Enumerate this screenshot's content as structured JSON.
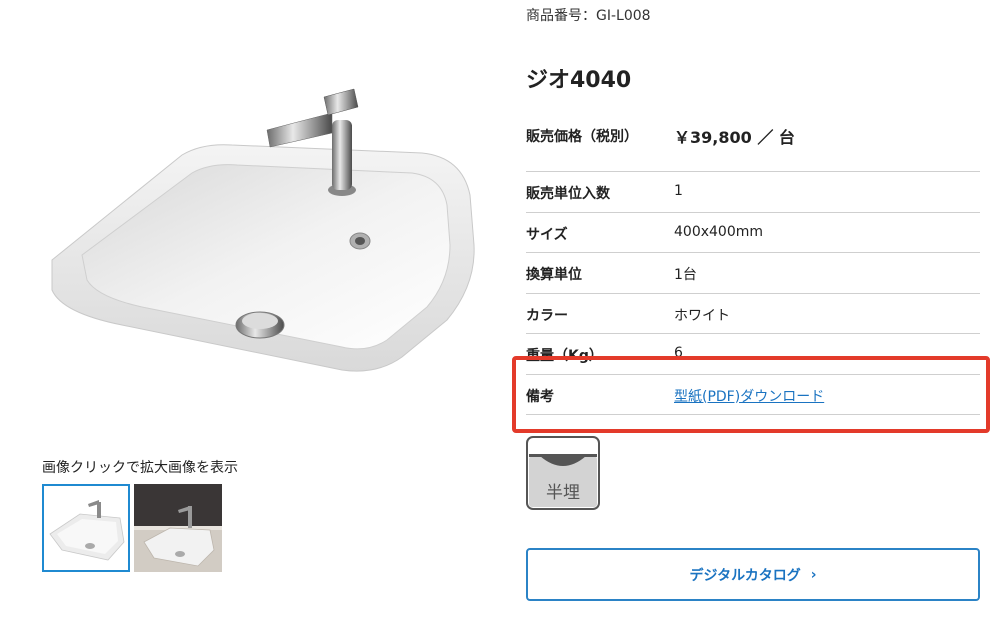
{
  "product": {
    "number_label": "商品番号：GI-L008",
    "name": "ジオ4040",
    "price_label": "販売価格（税別）",
    "price_value": "￥39,800 ／ 台"
  },
  "specs": [
    {
      "label": "販売単位入数",
      "value": "1"
    },
    {
      "label": "サイズ",
      "value": "400x400mm"
    },
    {
      "label": "換算単位",
      "value": "1台"
    },
    {
      "label": "カラー",
      "value": "ホワイト"
    },
    {
      "label": "重量（Kg）",
      "value": "6"
    },
    {
      "label": "備考",
      "value": "型紙(PDF)ダウンロード"
    }
  ],
  "gallery": {
    "caption": "画像クリックで拡大画像を表示"
  },
  "install_badge": {
    "label": "半埋"
  },
  "catalog_button": {
    "label": "デジタルカタログ",
    "chevron": "›"
  },
  "colors": {
    "accent": "#1a73c1",
    "highlight": "#e33a2a",
    "border": "#cfcfcf"
  }
}
